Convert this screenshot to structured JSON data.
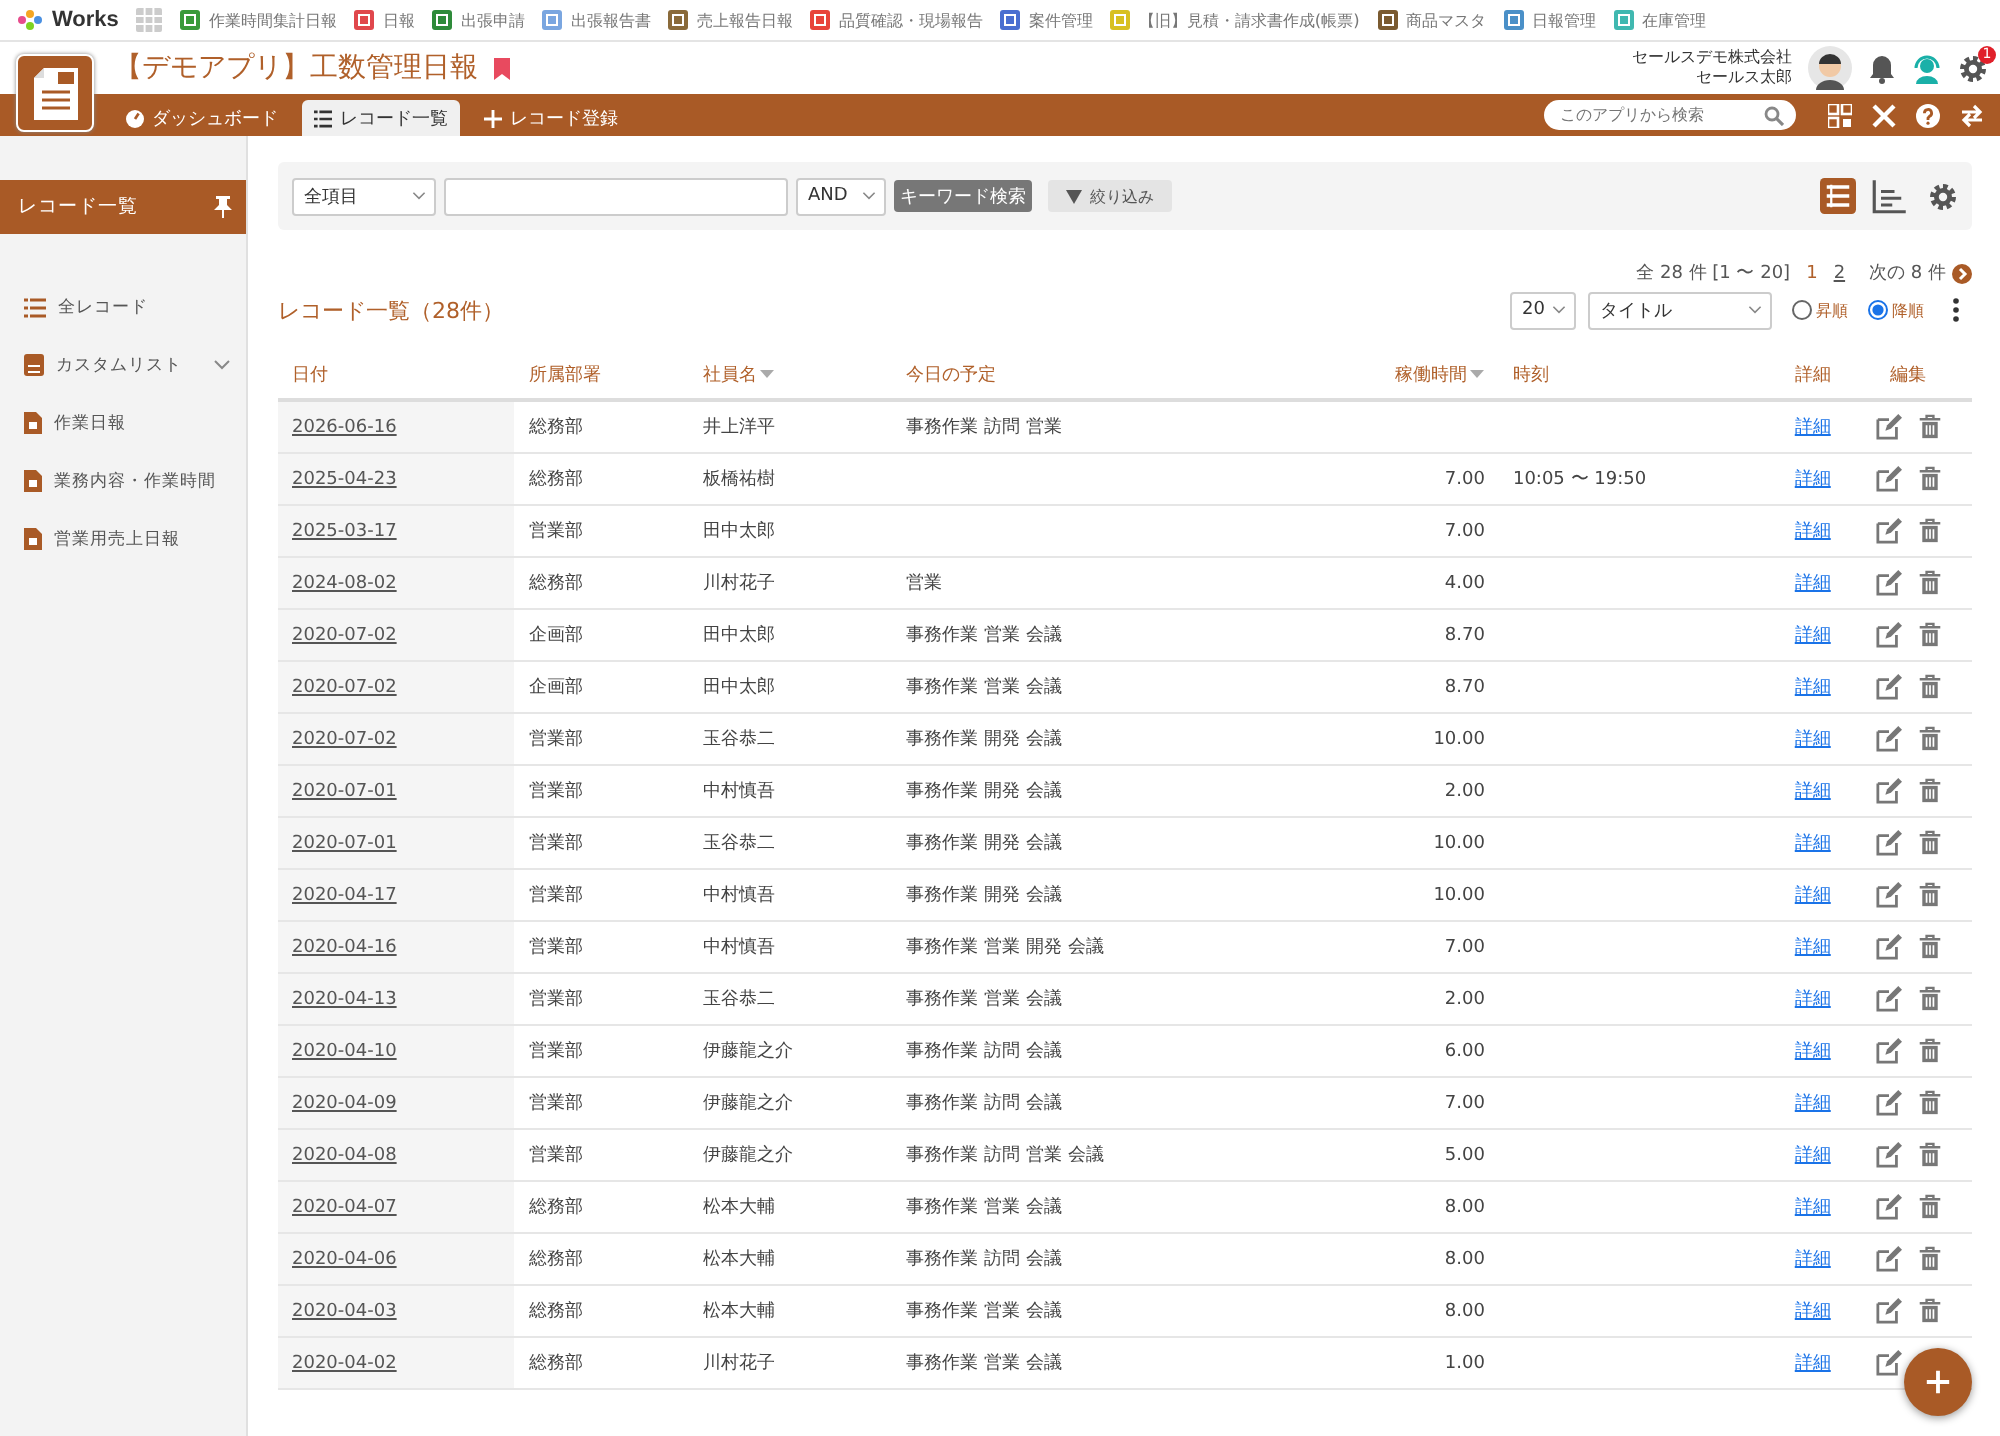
{
  "app_bar": {
    "logo_text": "Works",
    "apps": [
      {
        "label": "作業時間集計日報",
        "color": "#3a9a3a"
      },
      {
        "label": "日報",
        "color": "#e0474c"
      },
      {
        "label": "出張申請",
        "color": "#2e8b3a"
      },
      {
        "label": "出張報告書",
        "color": "#7aa6e0"
      },
      {
        "label": "売上報告日報",
        "color": "#8a6a3a"
      },
      {
        "label": "品質確認・現場報告",
        "color": "#e8453c"
      },
      {
        "label": "案件管理",
        "color": "#4a6fd0"
      },
      {
        "label": "【旧】見積・請求書作成(帳票)",
        "color": "#d8c020"
      },
      {
        "label": "商品マスタ",
        "color": "#7a5a30"
      },
      {
        "label": "日報管理",
        "color": "#4a90c8"
      },
      {
        "label": "在庫管理",
        "color": "#40b8b0"
      }
    ]
  },
  "header": {
    "title": "【デモアプリ】工数管理日報",
    "company": "セールスデモ株式会社",
    "user": "セールス太郎",
    "notification_badge": "1"
  },
  "nav_tabs": [
    {
      "label": "ダッシュボード",
      "selected": false
    },
    {
      "label": "レコード一覧",
      "selected": true
    },
    {
      "label": "レコード登録",
      "selected": false
    }
  ],
  "app_search": {
    "placeholder": "このアプリから検索"
  },
  "sidebar": {
    "title": "レコード一覧",
    "items": [
      {
        "label": "全レコード",
        "kind": "list"
      },
      {
        "label": "カスタムリスト",
        "kind": "group"
      },
      {
        "label": "作業日報",
        "kind": "file"
      },
      {
        "label": "業務内容・作業時間",
        "kind": "file"
      },
      {
        "label": "営業用売上日報",
        "kind": "file"
      }
    ]
  },
  "filter_bar": {
    "field_select": "全項目",
    "operator": "AND",
    "search_button": "キーワード検索",
    "narrow_button": "絞り込み",
    "views": [
      {
        "selected": true
      },
      {
        "selected": false
      }
    ]
  },
  "pagination": {
    "summary": "全 28 件 [1 〜 20]",
    "pages": [
      {
        "label": "1",
        "selected": true
      },
      {
        "label": "2",
        "selected": false
      }
    ],
    "next": "次の 8 件"
  },
  "list_title": "レコード一覧（28件）",
  "sort": {
    "page_size": "20",
    "field": "タイトル",
    "orders": [
      {
        "label": "昇順",
        "selected": false
      },
      {
        "label": "降順",
        "selected": true
      }
    ]
  },
  "table": {
    "columns": [
      {
        "label": "日付",
        "sorted": false
      },
      {
        "label": "所属部署",
        "sorted": false
      },
      {
        "label": "社員名",
        "sorted": true
      },
      {
        "label": "今日の予定",
        "sorted": false
      },
      {
        "label": "稼働時間",
        "sorted": true
      },
      {
        "label": "時刻",
        "sorted": false
      },
      {
        "label": "詳細",
        "sorted": false
      },
      {
        "label": "編集",
        "sorted": false
      }
    ],
    "rows": [
      [
        "2026-06-16",
        "総務部",
        "井上洋平",
        "事務作業 訪問 営業",
        "",
        "",
        "詳細"
      ],
      [
        "2025-04-23",
        "総務部",
        "板橋祐樹",
        "",
        "7.00",
        "10:05 〜 19:50",
        "詳細"
      ],
      [
        "2025-03-17",
        "営業部",
        "田中太郎",
        "",
        "7.00",
        "",
        "詳細"
      ],
      [
        "2024-08-02",
        "総務部",
        "川村花子",
        "営業",
        "4.00",
        "",
        "詳細"
      ],
      [
        "2020-07-02",
        "企画部",
        "田中太郎",
        "事務作業 営業 会議",
        "8.70",
        "",
        "詳細"
      ],
      [
        "2020-07-02",
        "企画部",
        "田中太郎",
        "事務作業 営業 会議",
        "8.70",
        "",
        "詳細"
      ],
      [
        "2020-07-02",
        "営業部",
        "玉谷恭二",
        "事務作業 開発 会議",
        "10.00",
        "",
        "詳細"
      ],
      [
        "2020-07-01",
        "営業部",
        "中村慎吾",
        "事務作業 開発 会議",
        "2.00",
        "",
        "詳細"
      ],
      [
        "2020-07-01",
        "営業部",
        "玉谷恭二",
        "事務作業 開発 会議",
        "10.00",
        "",
        "詳細"
      ],
      [
        "2020-04-17",
        "営業部",
        "中村慎吾",
        "事務作業 開発 会議",
        "10.00",
        "",
        "詳細"
      ],
      [
        "2020-04-16",
        "営業部",
        "中村慎吾",
        "事務作業 営業 開発 会議",
        "7.00",
        "",
        "詳細"
      ],
      [
        "2020-04-13",
        "営業部",
        "玉谷恭二",
        "事務作業 営業 会議",
        "2.00",
        "",
        "詳細"
      ],
      [
        "2020-04-10",
        "営業部",
        "伊藤龍之介",
        "事務作業 訪問 会議",
        "6.00",
        "",
        "詳細"
      ],
      [
        "2020-04-09",
        "営業部",
        "伊藤龍之介",
        "事務作業 訪問 会議",
        "7.00",
        "",
        "詳細"
      ],
      [
        "2020-04-08",
        "営業部",
        "伊藤龍之介",
        "事務作業 訪問 営業 会議",
        "5.00",
        "",
        "詳細"
      ],
      [
        "2020-04-07",
        "総務部",
        "松本大輔",
        "事務作業 営業 会議",
        "8.00",
        "",
        "詳細"
      ],
      [
        "2020-04-06",
        "総務部",
        "松本大輔",
        "事務作業 訪問 会議",
        "8.00",
        "",
        "詳細"
      ],
      [
        "2020-04-03",
        "総務部",
        "松本大輔",
        "事務作業 営業 会議",
        "8.00",
        "",
        "詳細"
      ],
      [
        "2020-04-02",
        "総務部",
        "川村花子",
        "事務作業 営業 会議",
        "1.00",
        "",
        "詳細"
      ]
    ]
  }
}
